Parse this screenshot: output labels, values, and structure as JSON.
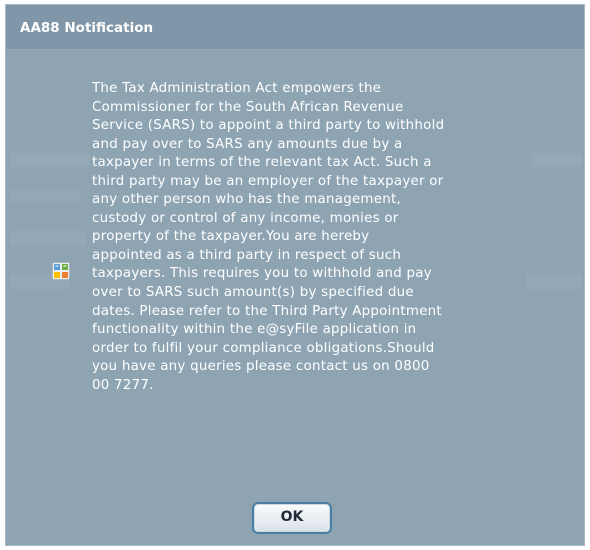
{
  "dialog": {
    "title": "AA88 Notification",
    "icon": "info-grid-icon",
    "message_lines": [
      "The Tax Administration Act empowers the",
      "Commissioner for the South African Revenue",
      "Service (SARS) to appoint a third party to withhold",
      "and pay over to SARS any amounts due by a",
      "taxpayer in terms of the relevant tax Act. Such a",
      "third party may be an employer of the taxpayer or",
      "any other person who has the management,",
      "custody or control of any income, monies or",
      "property of the taxpayer.You are hereby",
      "appointed as a third party in respect of such",
      "taxpayers. This requires you to withhold and pay",
      "over to SARS such amount(s) by specified due",
      "dates. Please refer to the Third Party Appointment",
      "functionality within the e@syFile application in",
      "order to fulfil your compliance obligations.Should",
      "you have any queries please contact us on 0800",
      "00 7277."
    ],
    "ok_label": "OK"
  },
  "colors": {
    "dialog_bg": "#8ea4b3",
    "titlebar_bg": "#7f97a8",
    "text": "#ffffff",
    "button_border": "#4a7ea3"
  }
}
